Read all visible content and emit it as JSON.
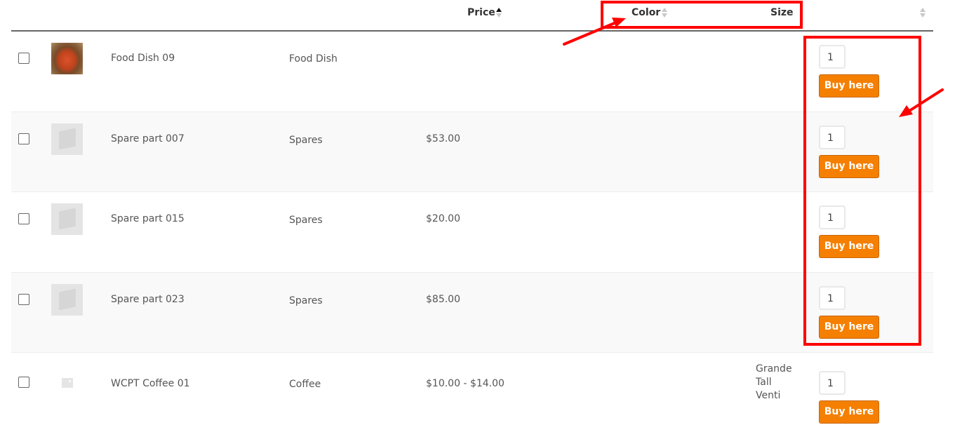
{
  "header": {
    "columns": [
      {
        "label": "Price",
        "sortable": true,
        "sort_state": "ascending"
      },
      {
        "label": "Color",
        "sortable": true,
        "sort_state": "none"
      },
      {
        "label": "Size",
        "sortable": false
      },
      {
        "label": "",
        "sortable": true,
        "sort_state": "none"
      }
    ]
  },
  "rows": [
    {
      "name": "Food Dish 09",
      "category": "Food Dish",
      "price": "",
      "size": [],
      "quantity": "1",
      "button": "Buy here",
      "thumbnail": "food-photo"
    },
    {
      "name": "Spare part 007",
      "category": "Spares",
      "price": "$53.00",
      "size": [],
      "quantity": "1",
      "button": "Buy here",
      "thumbnail": "cube-placeholder"
    },
    {
      "name": "Spare part 015",
      "category": "Spares",
      "price": "$20.00",
      "size": [],
      "quantity": "1",
      "button": "Buy here",
      "thumbnail": "cube-placeholder"
    },
    {
      "name": "Spare part 023",
      "category": "Spares",
      "price": "$85.00",
      "size": [],
      "quantity": "1",
      "button": "Buy here",
      "thumbnail": "cube-placeholder"
    },
    {
      "name": "WCPT Coffee 01",
      "category": "Coffee",
      "price": "$10.00 - $14.00",
      "size": [
        "Grande",
        "Tall",
        "Venti"
      ],
      "quantity": "1",
      "button": "Buy here",
      "thumbnail": "image-placeholder"
    }
  ],
  "annotations": {
    "color": "#ff0000",
    "highlights": [
      "header-color-size",
      "quantity-buy-column"
    ]
  },
  "colors": {
    "buy_button": "#f57f00",
    "alt_row": "#f9f9f9",
    "header_border": "#666666"
  }
}
